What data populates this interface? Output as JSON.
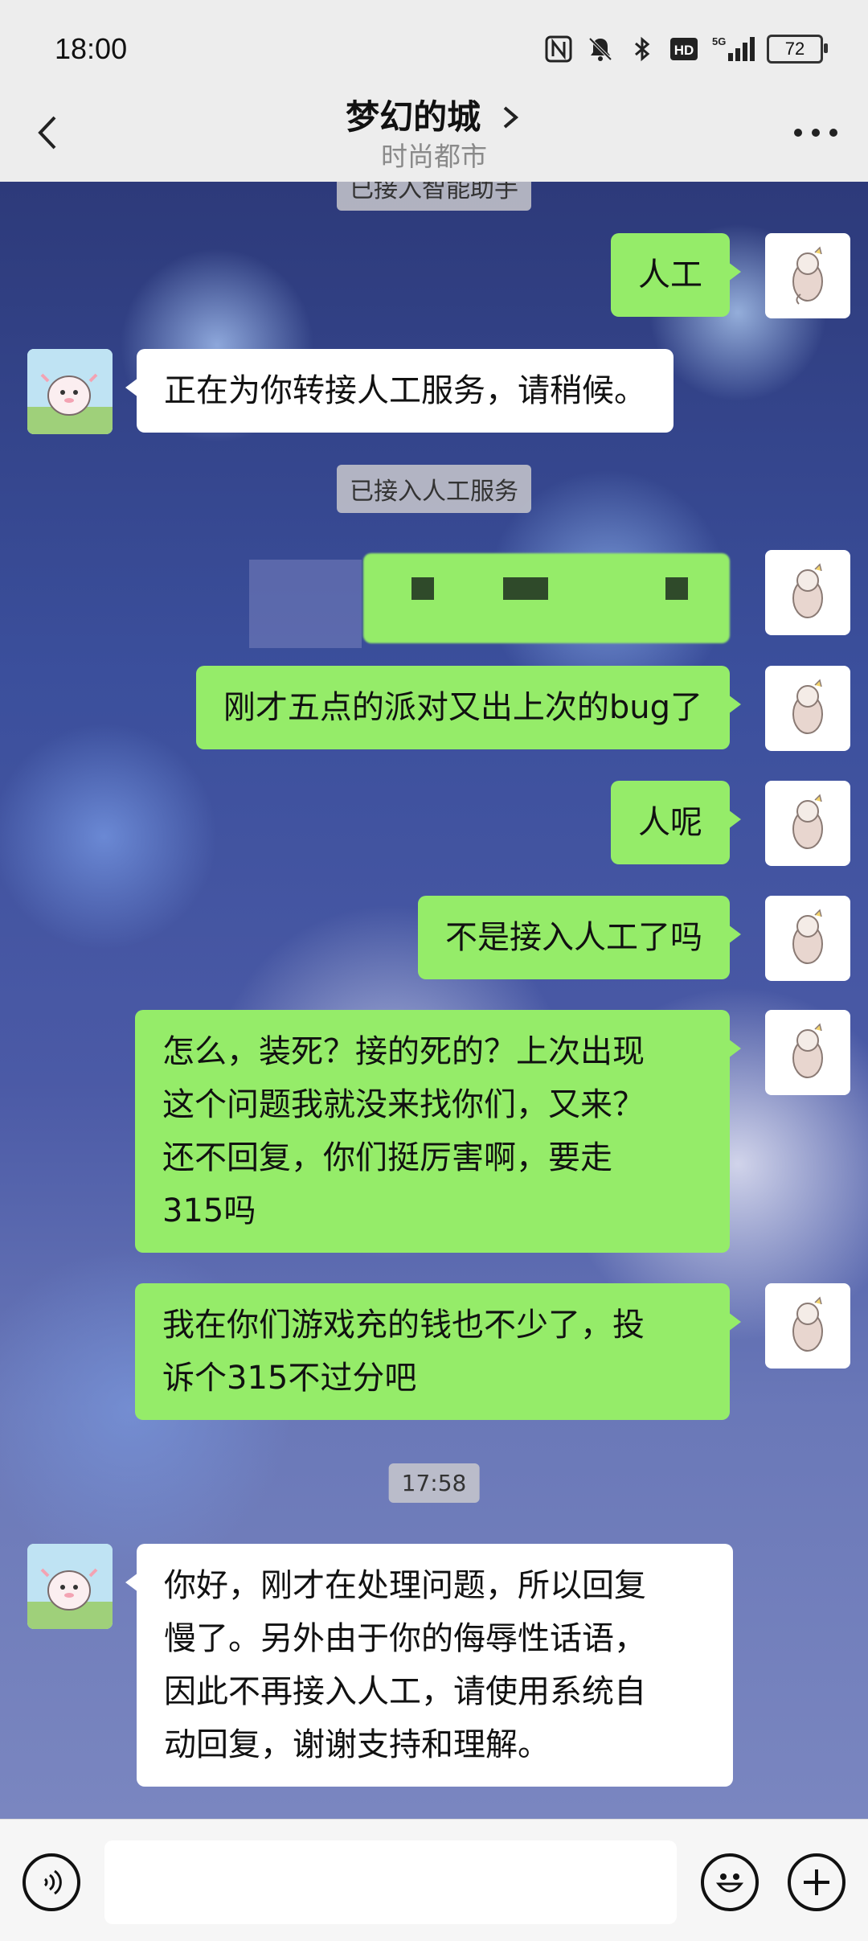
{
  "status_bar": {
    "time": "18:00",
    "battery": "72",
    "icons": [
      "nfc-icon",
      "mute-icon",
      "bluetooth-icon",
      "hd-icon",
      "5g-signal-icon",
      "battery-icon"
    ]
  },
  "header": {
    "title": "梦幻的城",
    "subtitle": "时尚都市",
    "back_icon": "chevron-left-icon",
    "title_icon": "chevron-right-icon",
    "more_icon": "more-dots-icon"
  },
  "messages": {
    "sys_top": "已接入智能助手",
    "m1": "人工",
    "m2": "正在为你转接人工服务，请稍候。",
    "sys_connected": "已接入人工服务",
    "m4": "刚才五点的派对又出上次的bug了",
    "m5": "人呢",
    "m6": "不是接入人工了吗",
    "m7": "怎么，装死？接的死的？上次出现\n这个问题我就没来找你们，又来？\n还不回复，你们挺厉害啊，要走\n315吗",
    "m8": "我在你们游戏充的钱也不少了，投\n诉个315不过分吧",
    "time_sep": "17:58",
    "m9": "你好，刚才在处理问题，所以回复\n慢了。另外由于你的侮辱性话语，\n因此不再接入人工，请使用系统自\n动回复，谢谢支持和理解。"
  },
  "input_bar": {
    "voice_icon": "voice-icon",
    "emoji_icon": "emoji-icon",
    "plus_icon": "plus-icon",
    "placeholder": ""
  },
  "colors": {
    "my_bubble": "#95ec69",
    "their_bubble": "#ffffff",
    "header_bg": "#ededed"
  }
}
